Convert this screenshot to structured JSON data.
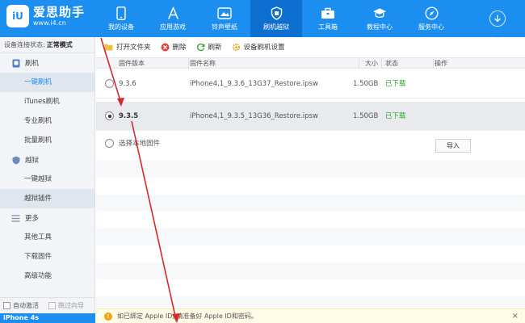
{
  "app": {
    "logo_badge": "iU",
    "logo_name": "爱思助手",
    "logo_url": "www.i4.cn"
  },
  "nav": [
    {
      "label": "我的设备",
      "icon": "phone-icon"
    },
    {
      "label": "应用游戏",
      "icon": "app-store-icon"
    },
    {
      "label": "铃声壁纸",
      "icon": "ringtone-wallpaper-icon"
    },
    {
      "label": "刷机越狱",
      "icon": "shield-icon"
    },
    {
      "label": "工具箱",
      "icon": "toolbox-icon"
    },
    {
      "label": "教程中心",
      "icon": "graduation-cap-icon"
    },
    {
      "label": "服务中心",
      "icon": "compass-icon"
    }
  ],
  "sidebar": {
    "status_label": "设备连接状态:",
    "status_value": "正常模式",
    "group_flash": "刷机",
    "flash_items": [
      "一键刷机",
      "iTunes刷机",
      "专业刷机",
      "批量刷机"
    ],
    "group_jailbreak": "越狱",
    "jailbreak_items": [
      "一键越狱",
      "越狱插件"
    ],
    "group_more": "更多",
    "more_items": [
      "其他工具",
      "下载固件",
      "高级功能"
    ],
    "auto_activate": "自动激活",
    "skip_guide": "跳过向导",
    "device_name": "iPhone 4s"
  },
  "toolbar": {
    "open_folder": "打开文件夹",
    "delete": "删除",
    "refresh": "刷新",
    "settings": "设备刷机设置"
  },
  "table": {
    "headers": {
      "version": "固件版本",
      "name": "固件名称",
      "size": "大小",
      "status": "状态",
      "action": "操作"
    },
    "rows": [
      {
        "version": "9.3.6",
        "name": "iPhone4,1_9.3.6_13G37_Restore.ipsw",
        "size": "1.50GB",
        "status": "已下载",
        "selected": false
      },
      {
        "version": "9.3.5",
        "name": "iPhone4,1_9.3.5_13G36_Restore.ipsw",
        "size": "1.50GB",
        "status": "已下载",
        "selected": true
      }
    ],
    "local_option": "选择本地固件",
    "import_label": "导入"
  },
  "notice": {
    "text": "如已绑定 Apple ID, 请准备好 Apple ID和密码。",
    "close": "×"
  },
  "colors": {
    "brand": "#1b8ef0",
    "nav_active": "#0d6fd0",
    "success": "#2aa52a",
    "annotation": "#d22b2b"
  }
}
